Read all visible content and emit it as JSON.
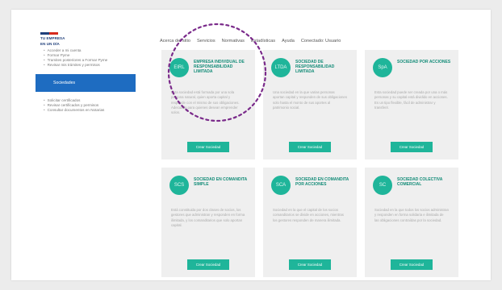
{
  "header": {
    "logo_text": [
      "TU EMPRESA",
      "EN UN DÍA"
    ],
    "logo_colors": [
      "#1f3f7a",
      "#d52b1e"
    ],
    "nav": [
      "Acerca del sitio",
      "Servicios",
      "Normativas",
      "Estadísticas",
      "Ayuda",
      "Conectado: Usuario"
    ]
  },
  "sidebar": {
    "items_top": [
      "Acceder a mi cuenta",
      "Formar Pyme",
      "Tramites posteriores a Formar Pyme",
      "Revisar mis trámites y permisos"
    ],
    "active_label": "Sociedades",
    "items_bottom": [
      "Solicitar certificados",
      "Revisar certificados y permisos",
      "Consultar documentos en Notarias"
    ]
  },
  "cards": [
    {
      "icon": "EIRL",
      "title": "EMPRESA INDIVIDUAL DE RESPONSABILIDAD LIMITADA",
      "desc": "Esta sociedad está formada por una sola persona natural, quien aporta capital y responde con el mismo de sus obligaciones. Adecuada para quienes desean emprender solos.",
      "button": "Crear Sociedad"
    },
    {
      "icon": "LTDA",
      "title": "SOCIEDAD DE RESPONSABILIDAD LIMITADA",
      "desc": "Una sociedad en la que varias personas aportan capital y responden de sus obligaciones solo hasta el monto de sus aportes al patrimonio social.",
      "button": "Crear Sociedad"
    },
    {
      "icon": "SpA",
      "title": "SOCIEDAD POR ACCIONES",
      "desc": "Esta sociedad puede ser creada por una o más personas y su capital está dividido en acciones. Es un tipo flexible, fácil de administrar y transferir.",
      "button": "Crear Sociedad"
    },
    {
      "icon": "SCS",
      "title": "SOCIEDAD EN COMANDITA SIMPLE",
      "desc": "Está constituida por dos clases de socios, los gestores que administran y responden en forma ilimitada, y los comanditarios que solo aportan capital.",
      "button": "Crear Sociedad"
    },
    {
      "icon": "SCA",
      "title": "SOCIEDAD EN COMANDITA POR ACCIONES",
      "desc": "Sociedad en la que el capital de los socios comanditarios se divide en acciones, mientras los gestores responden de manera ilimitada.",
      "button": "Crear Sociedad"
    },
    {
      "icon": "SC",
      "title": "SOCIEDAD COLECTIVA COMERCIAL",
      "desc": "Sociedad en la que todos los socios administran y responden en forma solidaria e ilimitada de las obligaciones contraídas por la sociedad.",
      "button": "Crear Sociedad"
    }
  ],
  "colors": {
    "accent": "#1fb59a",
    "sidebar_active": "#1e6cc1",
    "highlight": "#7a2a8a"
  }
}
